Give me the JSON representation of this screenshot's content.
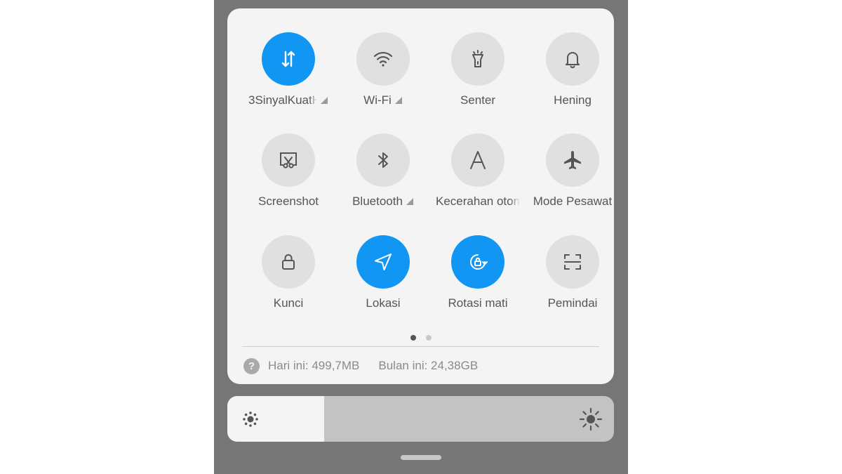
{
  "tiles": [
    {
      "id": "mobile-data",
      "label": "3SinyalKuatH",
      "icon": "data-arrows-icon",
      "active": true,
      "signal": true
    },
    {
      "id": "wifi",
      "label": "Wi-Fi",
      "icon": "wifi-icon",
      "active": false,
      "signal": true
    },
    {
      "id": "flashlight",
      "label": "Senter",
      "icon": "flashlight-icon",
      "active": false,
      "signal": false
    },
    {
      "id": "silent",
      "label": "Hening",
      "icon": "bell-icon",
      "active": false,
      "signal": false
    },
    {
      "id": "screenshot",
      "label": "Screenshot",
      "icon": "scissors-icon",
      "active": false,
      "signal": false
    },
    {
      "id": "bluetooth",
      "label": "Bluetooth",
      "icon": "bluetooth-icon",
      "active": false,
      "signal": true
    },
    {
      "id": "auto-brightness",
      "label": "Kecerahan otom",
      "icon": "auto-brightness-icon",
      "active": false,
      "signal": false
    },
    {
      "id": "airplane",
      "label": "Mode Pesawat",
      "icon": "airplane-icon",
      "active": false,
      "signal": false
    },
    {
      "id": "lock",
      "label": "Kunci",
      "icon": "lock-icon",
      "active": false,
      "signal": false
    },
    {
      "id": "location",
      "label": "Lokasi",
      "icon": "location-arrow-icon",
      "active": true,
      "signal": false
    },
    {
      "id": "rotation",
      "label": "Rotasi mati",
      "icon": "rotation-lock-icon",
      "active": true,
      "signal": false
    },
    {
      "id": "scanner",
      "label": "Pemindai",
      "icon": "scanner-icon",
      "active": false,
      "signal": false
    }
  ],
  "pagination": {
    "total": 2,
    "current": 0
  },
  "data_usage": {
    "help_icon": "?",
    "today": "Hari ini: 499,7MB",
    "month": "Bulan ini: 24,38GB"
  },
  "brightness": {
    "level": 0.25,
    "low_icon": "brightness-low-icon",
    "high_icon": "brightness-high-icon"
  },
  "colors": {
    "accent": "#1296f3",
    "tile_inactive": "#e0e0e0",
    "icon_inactive": "#555555",
    "panel": "#f4f4f4",
    "background": "#767676"
  }
}
